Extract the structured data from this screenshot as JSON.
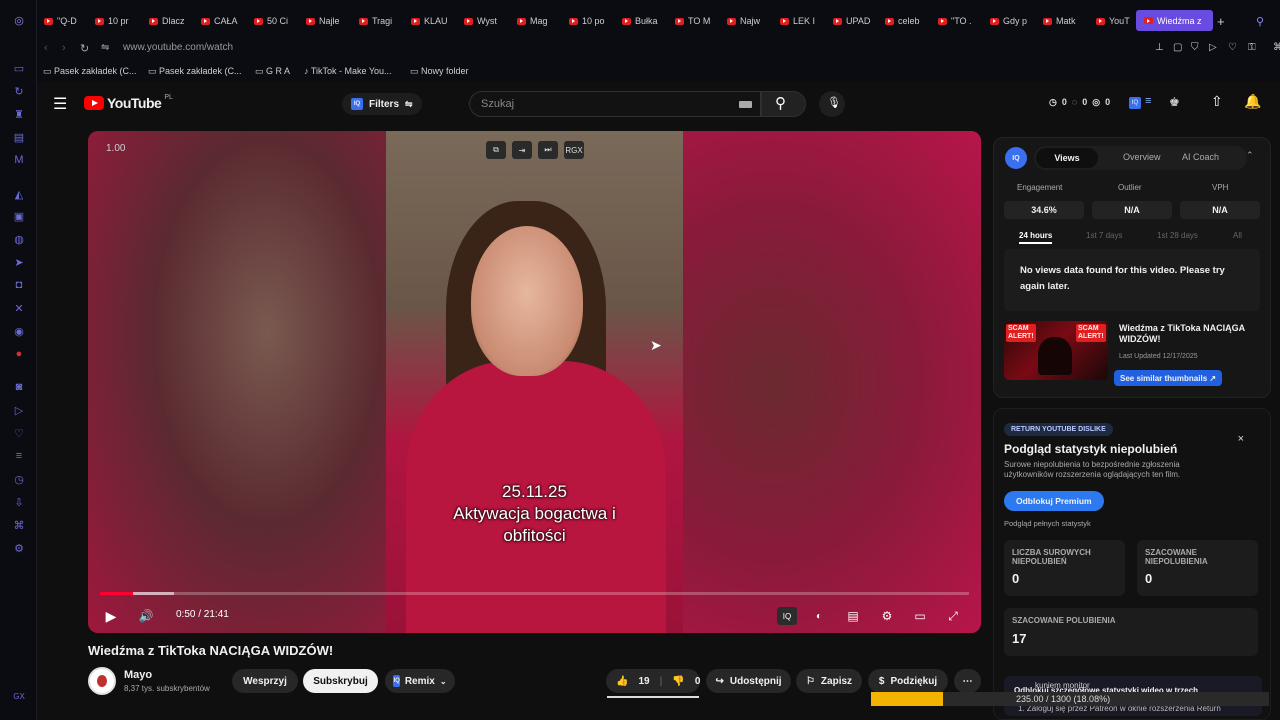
{
  "browser": {
    "tabs": [
      "\"Q-D",
      "10 pr",
      "Dlacz",
      "CAŁA",
      "50 Ci",
      "Najle",
      "Tragi",
      "KLAU",
      "Wyst",
      "Mag",
      "10 po",
      "Bułka",
      "TO M",
      "Najw",
      "LEK I",
      "UPAD",
      "celeb",
      "\"TO .",
      "Gdy p",
      "Matk",
      "YouT"
    ],
    "active_tab": "Wiedźma z",
    "url": "www.youtube.com/watch",
    "bookmarks": [
      "Pasek zakładek (C...",
      "Pasek zakładek (C...",
      "G R A",
      "TikTok - Make You...",
      "Nowy folder"
    ]
  },
  "masthead": {
    "logo_text": "YouTube",
    "logo_region": "PL",
    "filters_label": "Filters",
    "search_placeholder": "Szukaj",
    "counters": [
      "0",
      "0",
      "0"
    ]
  },
  "player": {
    "speed": "1.00",
    "top_controls": [
      "⧉",
      "⇥",
      "⏭",
      "RGX"
    ],
    "caption_lines": [
      "25.11.25",
      "Aktywacja bogactwa i",
      "obfitości"
    ],
    "time": "0:50 / 21:41",
    "progress": 0.038,
    "buffered": 0.085
  },
  "video": {
    "title": "Wiedźma z TikToka NACIĄGA WIDZÓW!",
    "channel": "Mayo",
    "subscribers": "8,37 tys. subskrybentów",
    "join_label": "Wesprzyj",
    "subscribe_label": "Subskrybuj",
    "remix_label": "Remix",
    "likes": "19",
    "dislikes": "0",
    "share_label": "Udostępnij",
    "save_label": "Zapisz",
    "thanks_label": "Podziękuj"
  },
  "iq_panel": {
    "tabs": [
      "Views",
      "Overview",
      "AI Coach"
    ],
    "metrics": [
      {
        "label": "Engagement",
        "value": "34.6%"
      },
      {
        "label": "Outlier",
        "value": "N/A"
      },
      {
        "label": "VPH",
        "value": "N/A"
      }
    ],
    "ranges": [
      "24 hours",
      "1st 7 days",
      "1st 28 days",
      "All"
    ],
    "no_data": "No views data found for this video. Please try again later.",
    "thumb_title": "Wiedźma z TikToka NACIĄGA WIDZÓW!",
    "last_updated": "Last Updated 12/17/2025",
    "similar_label": "See similar thumbnails ↗",
    "scam_label": "SCAM ALERT!"
  },
  "rd_panel": {
    "badge": "RETURN YOUTUBE DISLIKE",
    "heading": "Podgląd statystyk niepolubień",
    "description": "Surowe niepolubienia to bezpośrednie zgłoszenia użytkowników rozszerzenia oglądających ten film.",
    "unlock_label": "Odblokuj Premium",
    "preview_label": "Podgląd pełnych statystyk",
    "cards": [
      {
        "label": "LICZBA SUROWYCH NIEPOLUBIEŃ",
        "value": "0"
      },
      {
        "label": "SZACOWANE NIEPOLUBIENIA",
        "value": "0"
      },
      {
        "label": "SZACOWANE POLUBIENIA",
        "value": "17"
      }
    ],
    "footer_1": "Odblokuj szczegółowe statystyki wideo w trzech",
    "footer_2": "1. Zaloguj się przez Patreon w oknie rozszerzenia Return",
    "footer_overlay": "kuniem monitor"
  },
  "download": {
    "text": "235.00 / 1300 (18.08%)",
    "progress": 0.1808
  },
  "colors": {
    "accent": "#6a4be0",
    "youtube_red": "#ff0000",
    "iq_blue": "#3a6ff0",
    "progress_yellow": "#f2b400"
  }
}
